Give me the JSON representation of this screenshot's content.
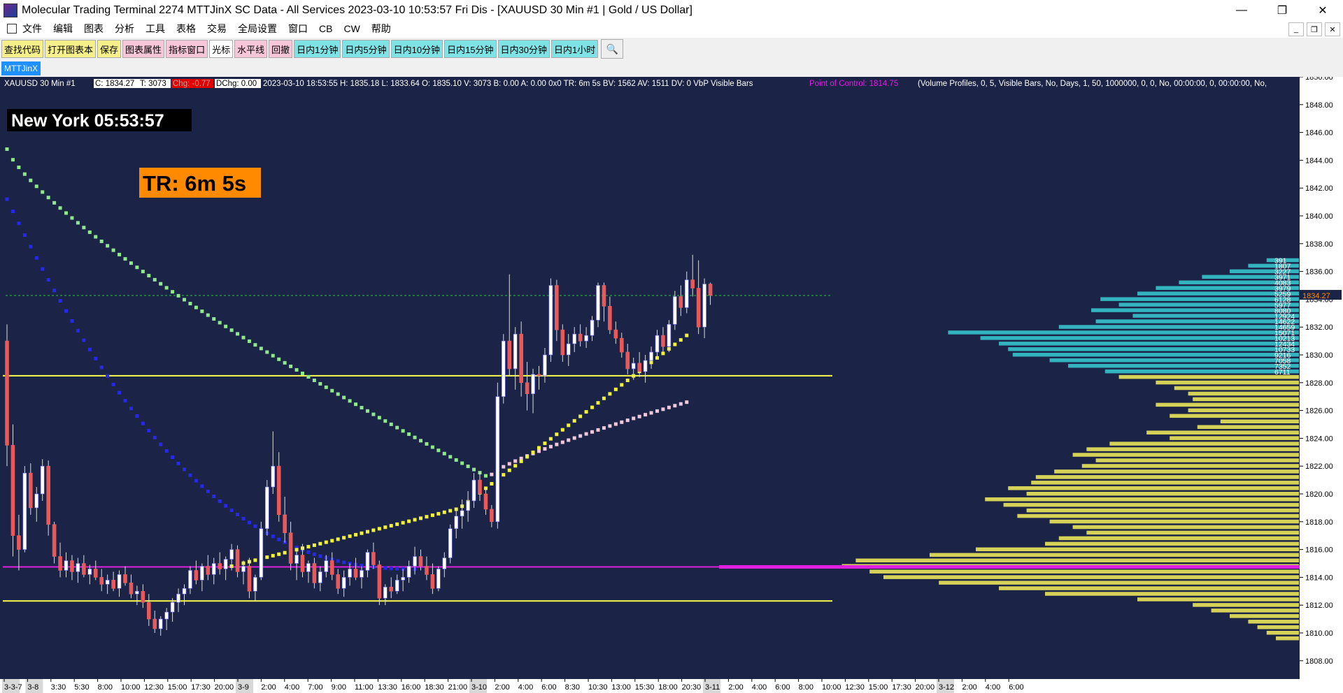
{
  "window": {
    "title": "Molecular Trading Terminal 2274 MTTJinX  SC Data - All Services 2023-03-10  10:53:57 Fri  Dis - [XAUUSD  30 Min  #1 | Gold / US Dollar]",
    "min_glyph": "—",
    "max_glyph": "❐",
    "close_glyph": "✕"
  },
  "menu": [
    "文件",
    "编辑",
    "图表",
    "分析",
    "工具",
    "表格",
    "交易",
    "全局设置",
    "窗口",
    "CB",
    "CW",
    "帮助"
  ],
  "mdi": [
    "_",
    "❐",
    "✕"
  ],
  "toolbar": [
    {
      "label": "查找代码",
      "bg": "#f5f08a"
    },
    {
      "label": "打开图表本",
      "bg": "#f5f08a"
    },
    {
      "label": "保存",
      "bg": "#f5f08a"
    },
    {
      "label": "图表属性",
      "bg": "#f7c6d9"
    },
    {
      "label": "指标窗口",
      "bg": "#f7c6d9"
    },
    {
      "label": "光标",
      "bg": "#ffffff"
    },
    {
      "label": "水平线",
      "bg": "#f7c6d9"
    },
    {
      "label": "回撤",
      "bg": "#f7c6d9"
    },
    {
      "label": "日内1分钟",
      "bg": "#7fe3e6"
    },
    {
      "label": "日内5分钟",
      "bg": "#7fe3e6"
    },
    {
      "label": "日内10分钟",
      "bg": "#7fe3e6"
    },
    {
      "label": "日内15分钟",
      "bg": "#7fe3e6"
    },
    {
      "label": "日内30分钟",
      "bg": "#7fe3e6"
    },
    {
      "label": "日内1小时",
      "bg": "#7fe3e6"
    }
  ],
  "tab": {
    "label": "MTTJinX"
  },
  "chart": {
    "info_prefix": "XAUUSD  30 Min   #1",
    "close_label": "C: 1834.27",
    "trades_label": "T: 3073",
    "change_label": "Chg: -0.77",
    "dchange_label": "DChg: 0.00",
    "info_main": "2023-03-10 18:53:55 H: 1835.18 L: 1833.64 O: 1835.10 V: 3073 B: 0.00 A: 0.00 0x0 TR: 6m 5s BV: 1562 AV: 1511 DV: 0 VbP Visible Bars",
    "poc_label": "Point of Control: 1814.75",
    "vp_params": "(Volume Profiles, 0, 5, Visible Bars, No, Days, 1, 50, 1000000, 0, 0, No, 00:00:00, 0, 00:00:00, No,",
    "clock_text": "New York 05:53:57",
    "timer_text": "TR: 6m 5s",
    "last_price_label": "1834.27",
    "colors": {
      "background": "#1b2347",
      "up_candle": "#ffffff",
      "down_candle": "#e85a5a",
      "wick": "#dcdcdc",
      "poc": "#e020e0",
      "level": "#ffff4a",
      "profile_above": "#35c0c8",
      "profile_below": "#e6e25a",
      "green_dots": "#90e88c",
      "blue_dots": "#2828e8",
      "yellow_dots": "#f2f236",
      "pink_dots": "#f0c8dc",
      "timer_bg": "#ff8a00",
      "axis_text": "#000000"
    }
  },
  "y_ticks": [
    "1850.00",
    "1848.00",
    "1846.00",
    "1844.00",
    "1842.00",
    "1840.00",
    "1838.00",
    "1836.00",
    "1834.00",
    "1832.00",
    "1830.00",
    "1828.00",
    "1826.00",
    "1824.00",
    "1822.00",
    "1820.00",
    "1818.00",
    "1816.00",
    "1814.00",
    "1812.00",
    "1810.00",
    "1808.00"
  ],
  "x_ticks": [
    {
      "label": "3-3-7",
      "day": true
    },
    {
      "label": "3-8",
      "day": true
    },
    {
      "label": "3:30"
    },
    {
      "label": "5:30"
    },
    {
      "label": "8:00"
    },
    {
      "label": "10:00"
    },
    {
      "label": "12:30"
    },
    {
      "label": "15:00"
    },
    {
      "label": "17:30"
    },
    {
      "label": "20:00"
    },
    {
      "label": "3-9",
      "day": true
    },
    {
      "label": "2:00"
    },
    {
      "label": "4:00"
    },
    {
      "label": "7:00"
    },
    {
      "label": "9:00"
    },
    {
      "label": "11:00"
    },
    {
      "label": "13:30"
    },
    {
      "label": "16:00"
    },
    {
      "label": "18:30"
    },
    {
      "label": "21:00"
    },
    {
      "label": "3-10",
      "day": true
    },
    {
      "label": "2:00"
    },
    {
      "label": "4:00"
    },
    {
      "label": "6:00"
    },
    {
      "label": "8:30"
    },
    {
      "label": "10:30"
    },
    {
      "label": "13:00"
    },
    {
      "label": "15:30"
    },
    {
      "label": "18:00"
    },
    {
      "label": "20:30"
    },
    {
      "label": "3-11",
      "day": true
    },
    {
      "label": "2:00"
    },
    {
      "label": "4:00"
    },
    {
      "label": "6:00"
    },
    {
      "label": "8:00"
    },
    {
      "label": "10:00"
    },
    {
      "label": "12:30"
    },
    {
      "label": "15:00"
    },
    {
      "label": "17:30"
    },
    {
      "label": "20:00"
    },
    {
      "label": "3-12",
      "day": true
    },
    {
      "label": "2:00"
    },
    {
      "label": "4:00"
    },
    {
      "label": "6:00"
    }
  ],
  "levels": {
    "upper": 1828.5,
    "poc": 1814.75,
    "lower": 1812.3,
    "last_close": 1834.27
  },
  "profile_labels": [
    "391",
    "1807",
    "3227",
    "3971",
    "4083",
    "3979",
    "5259",
    "6128",
    "5977",
    "8080",
    "12924",
    "14622",
    "14659",
    "15071",
    "10213",
    "12434",
    "10733",
    "9216",
    "7058",
    "7352",
    "6711"
  ],
  "candles": [
    [
      1831,
      1832.2,
      1822,
      1823.5
    ],
    [
      1823.5,
      1825,
      1815.5,
      1817
    ],
    [
      1817,
      1818.5,
      1814.5,
      1816
    ],
    [
      1816,
      1822,
      1815.8,
      1821.5
    ],
    [
      1821.5,
      1822.2,
      1818.5,
      1819
    ],
    [
      1819,
      1820.5,
      1818,
      1820
    ],
    [
      1820,
      1822.5,
      1819.5,
      1822
    ],
    [
      1822,
      1822.4,
      1817,
      1817.8
    ],
    [
      1817.8,
      1818,
      1815,
      1815.5
    ],
    [
      1815.5,
      1816.5,
      1814,
      1814.5
    ],
    [
      1814.5,
      1815.8,
      1814,
      1815.2
    ],
    [
      1815.2,
      1815.6,
      1813.8,
      1814.4
    ],
    [
      1814.4,
      1815.4,
      1813.6,
      1815
    ],
    [
      1815,
      1815.6,
      1814,
      1814.2
    ],
    [
      1814.2,
      1814.9,
      1813.5,
      1814.6
    ],
    [
      1814.6,
      1815.2,
      1813.8,
      1814
    ],
    [
      1814,
      1814.6,
      1813,
      1813.5
    ],
    [
      1813.5,
      1814.2,
      1812.8,
      1813.8
    ],
    [
      1813.8,
      1814.4,
      1813,
      1813.2
    ],
    [
      1813.2,
      1814.5,
      1812.6,
      1814.2
    ],
    [
      1814.2,
      1814.8,
      1813.4,
      1813.6
    ],
    [
      1813.6,
      1814.2,
      1812.5,
      1812.8
    ],
    [
      1812.8,
      1813.4,
      1812,
      1813
    ],
    [
      1813,
      1813.5,
      1811.8,
      1812.2
    ],
    [
      1812.2,
      1812.8,
      1810.5,
      1811
    ],
    [
      1811,
      1811.6,
      1810,
      1810.3
    ],
    [
      1810.3,
      1811.2,
      1809.8,
      1811
    ],
    [
      1811,
      1811.8,
      1810.2,
      1811.5
    ],
    [
      1811.5,
      1812.5,
      1810.8,
      1812.2
    ],
    [
      1812.2,
      1813.2,
      1811.5,
      1812.8
    ],
    [
      1812.8,
      1813.5,
      1812,
      1813.2
    ],
    [
      1813.2,
      1814.8,
      1812.8,
      1814.5
    ],
    [
      1814.5,
      1815.2,
      1813.5,
      1813.8
    ],
    [
      1813.8,
      1815,
      1813,
      1814.8
    ],
    [
      1814.8,
      1815.6,
      1813.8,
      1814.2
    ],
    [
      1814.2,
      1815.4,
      1813.5,
      1815
    ],
    [
      1815,
      1815.8,
      1814.2,
      1814.6
    ],
    [
      1814.6,
      1815.5,
      1813.8,
      1815.3
    ],
    [
      1815.3,
      1816.4,
      1814.5,
      1816
    ],
    [
      1816,
      1816.3,
      1814,
      1814.4
    ],
    [
      1814.4,
      1815.2,
      1813.5,
      1814.8
    ],
    [
      1814.8,
      1815.4,
      1812.5,
      1813
    ],
    [
      1813,
      1814.2,
      1812.3,
      1814
    ],
    [
      1814,
      1818,
      1813.8,
      1817.5
    ],
    [
      1817.5,
      1821,
      1817,
      1820.5
    ],
    [
      1820.5,
      1824.5,
      1820,
      1822
    ],
    [
      1822,
      1823,
      1818,
      1818.5
    ],
    [
      1818.5,
      1819.8,
      1816.5,
      1817.2
    ],
    [
      1817.2,
      1818,
      1814.5,
      1815
    ],
    [
      1815,
      1816,
      1813.8,
      1815.6
    ],
    [
      1815.6,
      1816.4,
      1814,
      1814.4
    ],
    [
      1814.4,
      1815.2,
      1813.6,
      1815
    ],
    [
      1815,
      1815.4,
      1813.2,
      1813.6
    ],
    [
      1813.6,
      1814.8,
      1813,
      1814.4
    ],
    [
      1814.4,
      1815.6,
      1814,
      1815.2
    ],
    [
      1815.2,
      1815.8,
      1813.8,
      1814.2
    ],
    [
      1814.2,
      1814.6,
      1812.8,
      1813.2
    ],
    [
      1813.2,
      1814.5,
      1812.6,
      1814
    ],
    [
      1814,
      1815,
      1813.4,
      1814.6
    ],
    [
      1814.6,
      1815.4,
      1813.8,
      1814
    ],
    [
      1814,
      1814.8,
      1813.2,
      1814.5
    ],
    [
      1814.5,
      1816,
      1814,
      1815.8
    ],
    [
      1815.8,
      1816.5,
      1814.6,
      1814.9
    ],
    [
      1814.9,
      1815.2,
      1812,
      1812.5
    ],
    [
      1812.5,
      1813.5,
      1812,
      1813.3
    ],
    [
      1813.3,
      1814,
      1812.5,
      1813
    ],
    [
      1813,
      1814.2,
      1812.8,
      1813.8
    ],
    [
      1813.8,
      1814.6,
      1813,
      1814
    ],
    [
      1814,
      1815.2,
      1813.6,
      1814.8
    ],
    [
      1814.8,
      1816.2,
      1814.2,
      1815.5
    ],
    [
      1815.5,
      1816,
      1814.5,
      1814.8
    ],
    [
      1814.8,
      1815.5,
      1813.8,
      1814.2
    ],
    [
      1814.2,
      1815,
      1812.8,
      1813.2
    ],
    [
      1813.2,
      1814.8,
      1813,
      1814.6
    ],
    [
      1814.6,
      1815.8,
      1814,
      1815.4
    ],
    [
      1815.4,
      1817.8,
      1815,
      1817.5
    ],
    [
      1817.5,
      1819,
      1816.8,
      1818.4
    ],
    [
      1818.4,
      1819.6,
      1817.5,
      1818.8
    ],
    [
      1818.8,
      1820.2,
      1818,
      1819.5
    ],
    [
      1819.5,
      1821.5,
      1819,
      1821
    ],
    [
      1821,
      1821.6,
      1819.5,
      1820
    ],
    [
      1820,
      1820.4,
      1818.5,
      1818.9
    ],
    [
      1818.9,
      1819.2,
      1817.6,
      1818
    ],
    [
      1818,
      1828,
      1817.5,
      1827
    ],
    [
      1827,
      1831.5,
      1826.5,
      1831
    ],
    [
      1831,
      1835.8,
      1828.5,
      1829
    ],
    [
      1829,
      1832,
      1827.5,
      1831.5
    ],
    [
      1831.5,
      1832.4,
      1827,
      1828
    ],
    [
      1828,
      1829.5,
      1826,
      1827.2
    ],
    [
      1827.2,
      1829,
      1825.8,
      1828.6
    ],
    [
      1828.6,
      1829.2,
      1827.5,
      1828.5
    ],
    [
      1828.5,
      1830.5,
      1828,
      1830
    ],
    [
      1830,
      1835.5,
      1829.5,
      1835
    ],
    [
      1835,
      1835.4,
      1831,
      1831.8
    ],
    [
      1831.8,
      1832.2,
      1829.5,
      1830
    ],
    [
      1830,
      1831.5,
      1829.2,
      1830.8
    ],
    [
      1830.8,
      1832,
      1830.2,
      1831.5
    ],
    [
      1831.5,
      1832.2,
      1830.6,
      1831
    ],
    [
      1831,
      1832,
      1830.5,
      1831.4
    ],
    [
      1831.4,
      1832.8,
      1831,
      1832.5
    ],
    [
      1832.5,
      1835.2,
      1832,
      1835
    ],
    [
      1835,
      1835.2,
      1832.4,
      1833.5
    ],
    [
      1833.5,
      1834.2,
      1831.5,
      1831.8
    ],
    [
      1831.8,
      1832.4,
      1830.8,
      1831.2
    ],
    [
      1831.2,
      1831.6,
      1829.8,
      1830.2
    ],
    [
      1830.2,
      1830.8,
      1828.6,
      1829
    ],
    [
      1829,
      1829.8,
      1828.2,
      1829.4
    ],
    [
      1829.4,
      1830.2,
      1828.4,
      1828.8
    ],
    [
      1828.8,
      1830,
      1828,
      1829.6
    ],
    [
      1829.6,
      1830.6,
      1829,
      1830.2
    ],
    [
      1830.2,
      1831.8,
      1829.8,
      1831.4
    ],
    [
      1831.4,
      1832,
      1830.2,
      1830.6
    ],
    [
      1830.6,
      1832.5,
      1830.2,
      1832.2
    ],
    [
      1832.2,
      1834.6,
      1831.8,
      1834.2
    ],
    [
      1834.2,
      1835,
      1832.8,
      1833.4
    ],
    [
      1833.4,
      1836,
      1833,
      1835.4
    ],
    [
      1835.4,
      1837.2,
      1834.2,
      1834.8
    ],
    [
      1834.8,
      1836.8,
      1831.5,
      1832
    ],
    [
      1832,
      1835.5,
      1831.2,
      1835.1
    ],
    [
      1835.1,
      1835.2,
      1833.6,
      1834.27
    ]
  ],
  "poc_line": {
    "label": "POC",
    "value": 1814.75
  }
}
